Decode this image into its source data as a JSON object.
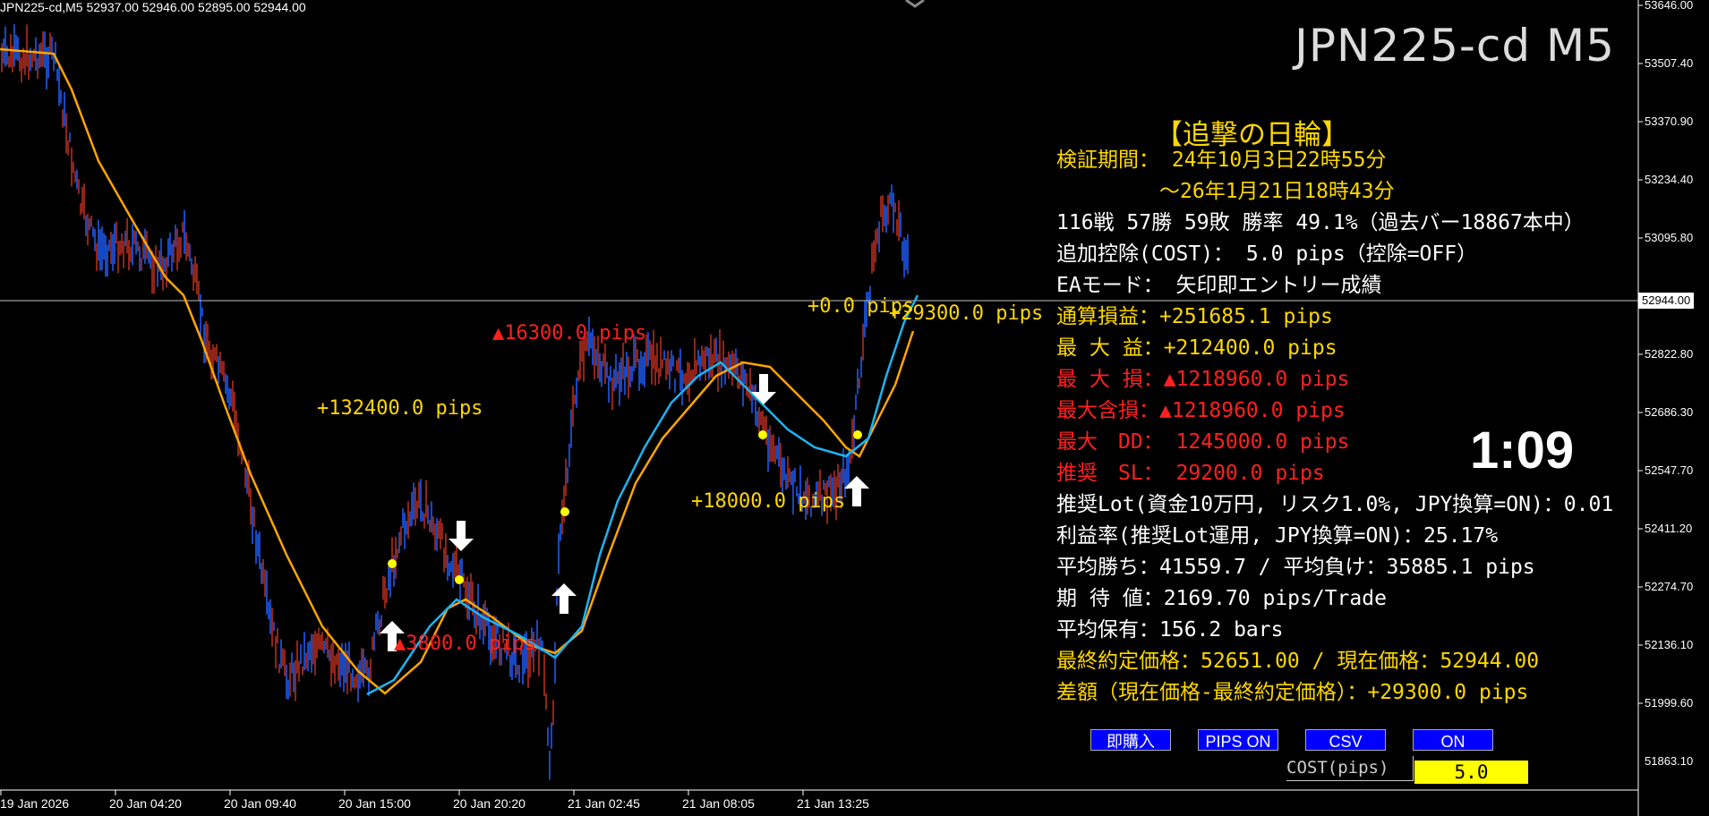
{
  "symbol_info": "JPN225-cd,M5  52937.00 52946.00 52895.00 52944.00",
  "chart_title": "JPN225-cd M5",
  "timer": "1:09",
  "panel": {
    "title": "【追撃の日輪】",
    "lines": [
      {
        "text": "検証期間： 24年10月3日22時55分",
        "color": "yellow"
      },
      {
        "text": "　　　　　～26年1月21日18時43分",
        "color": "yellow"
      },
      {
        "text": "116戦 57勝 59敗 勝率 49.1%（過去バー18867本中）",
        "color": "white"
      },
      {
        "text": "追加控除(COST)： 5.0 pips（控除=OFF）",
        "color": "white"
      },
      {
        "text": "EAモード： 矢印即エントリー成績",
        "color": "white"
      },
      {
        "text": "通算損益：+251685.1 pips",
        "color": "yellow"
      },
      {
        "text": "最 大 益：+212400.0 pips",
        "color": "yellow"
      },
      {
        "text": "最 大 損：▲1218960.0 pips",
        "color": "red"
      },
      {
        "text": "最大含損：▲1218960.0 pips",
        "color": "red"
      },
      {
        "text": "最大　DD： 1245000.0 pips",
        "color": "red"
      },
      {
        "text": "推奨　SL： 29200.0 pips",
        "color": "red"
      },
      {
        "text": "推奨Lot(資金10万円, リスク1.0%, JPY換算=ON)：0.01",
        "color": "white"
      },
      {
        "text": "利益率(推奨Lot運用, JPY換算=ON)：25.17%",
        "color": "white"
      },
      {
        "text": "平均勝ち：41559.7 / 平均負け：35885.1 pips",
        "color": "white"
      },
      {
        "text": "期 待 値：2169.70 pips/Trade",
        "color": "white"
      },
      {
        "text": "平均保有：156.2 bars",
        "color": "white"
      },
      {
        "text": "最終約定価格：52651.00 / 現在価格：52944.00",
        "color": "yellow"
      },
      {
        "text": "差額（現在価格-最終約定価格）：+29300.0 pips",
        "color": "yellow"
      }
    ]
  },
  "price_axis": [
    "53646.00",
    "53507.40",
    "53370.90",
    "53234.40",
    "53095.80",
    "52822.80",
    "52686.30",
    "52547.70",
    "52411.20",
    "52274.70",
    "52136.10",
    "51999.60",
    "51863.10"
  ],
  "current_price": "52944.00",
  "time_axis": [
    "19 Jan 2026",
    "20 Jan 04:20",
    "20 Jan 09:40",
    "20 Jan 15:00",
    "20 Jan 20:20",
    "21 Jan 02:45",
    "21 Jan 08:05",
    "21 Jan 13:25"
  ],
  "chart_notes": [
    {
      "text": "+132400.0 pips",
      "color": "yellow"
    },
    {
      "text": "▲16300.0 pips",
      "color": "red"
    },
    {
      "text": "▲3800.0 pips",
      "color": "red"
    },
    {
      "text": "+0.0 pips",
      "color": "yellow"
    },
    {
      "text": "+29300.0 pips",
      "color": "yellow"
    },
    {
      "text": "+18000.0 pips",
      "color": "yellow"
    }
  ],
  "buttons": {
    "buy_now": "即購入",
    "pips": "PIPS ON",
    "csv": "CSV",
    "on": "ON"
  },
  "cost": {
    "label": "COST(pips)",
    "value": "5.0"
  },
  "colors": {
    "orange_ma": "#ffa500",
    "blue_ma": "#1eb4f0",
    "candle_up": "#2060ff",
    "candle_down": "#c03020",
    "marker": "#ffff00"
  },
  "icons": {
    "up_arrow": "white-up-arrow-icon",
    "down_arrow": "white-down-arrow-icon",
    "signal_dot": "yellow-dot-icon"
  }
}
